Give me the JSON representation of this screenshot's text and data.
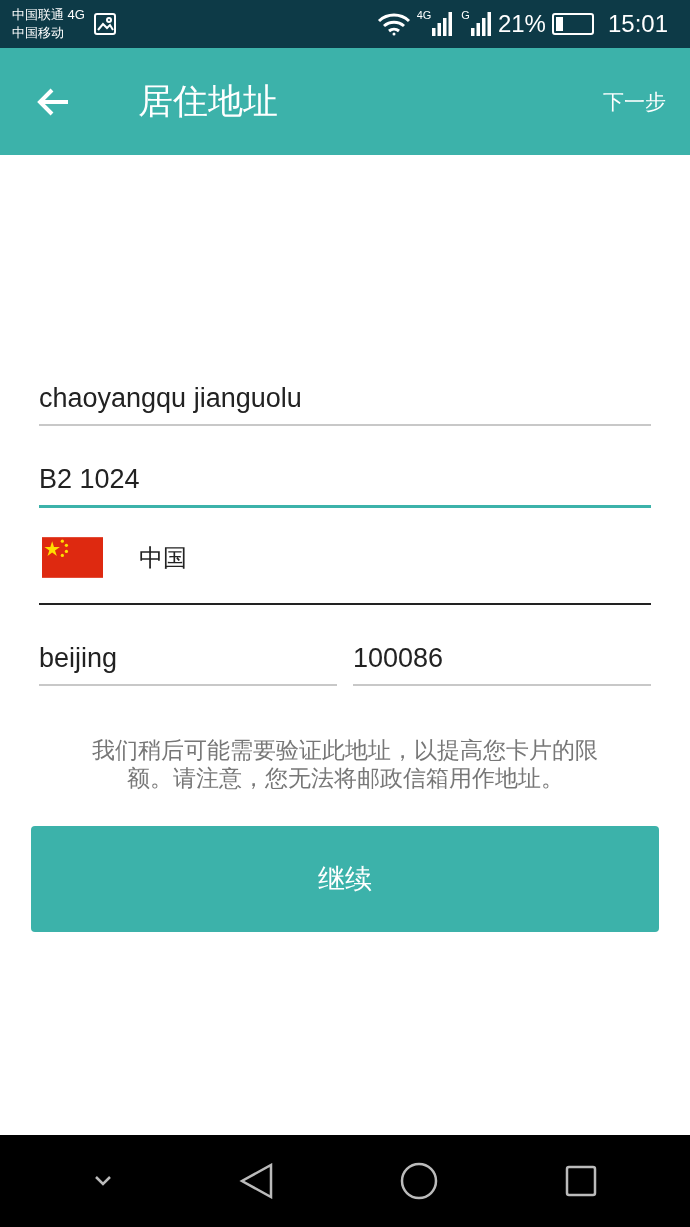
{
  "status_bar": {
    "carriers": [
      "中国联通 4G",
      "中国移动"
    ],
    "signals": [
      {
        "label": "4G"
      },
      {
        "label": "G"
      }
    ],
    "battery": "21%",
    "time": "15:01"
  },
  "header": {
    "title": "居住地址",
    "action": "下一步"
  },
  "address_fields": [
    {
      "value": "chaoyangqu jianguolu",
      "focused": false
    },
    {
      "value": "B2 1024",
      "focused": true
    }
  ],
  "country": {
    "name": "中国"
  },
  "city": {
    "value": "beijing",
    "focused": false
  },
  "postal_code": {
    "value": "100086",
    "focused": false
  },
  "note": "我们稍后可能需要验证此地址，以提高您卡片的限额。请注意，您无法将邮政信箱用作地址。",
  "button": "继续"
}
